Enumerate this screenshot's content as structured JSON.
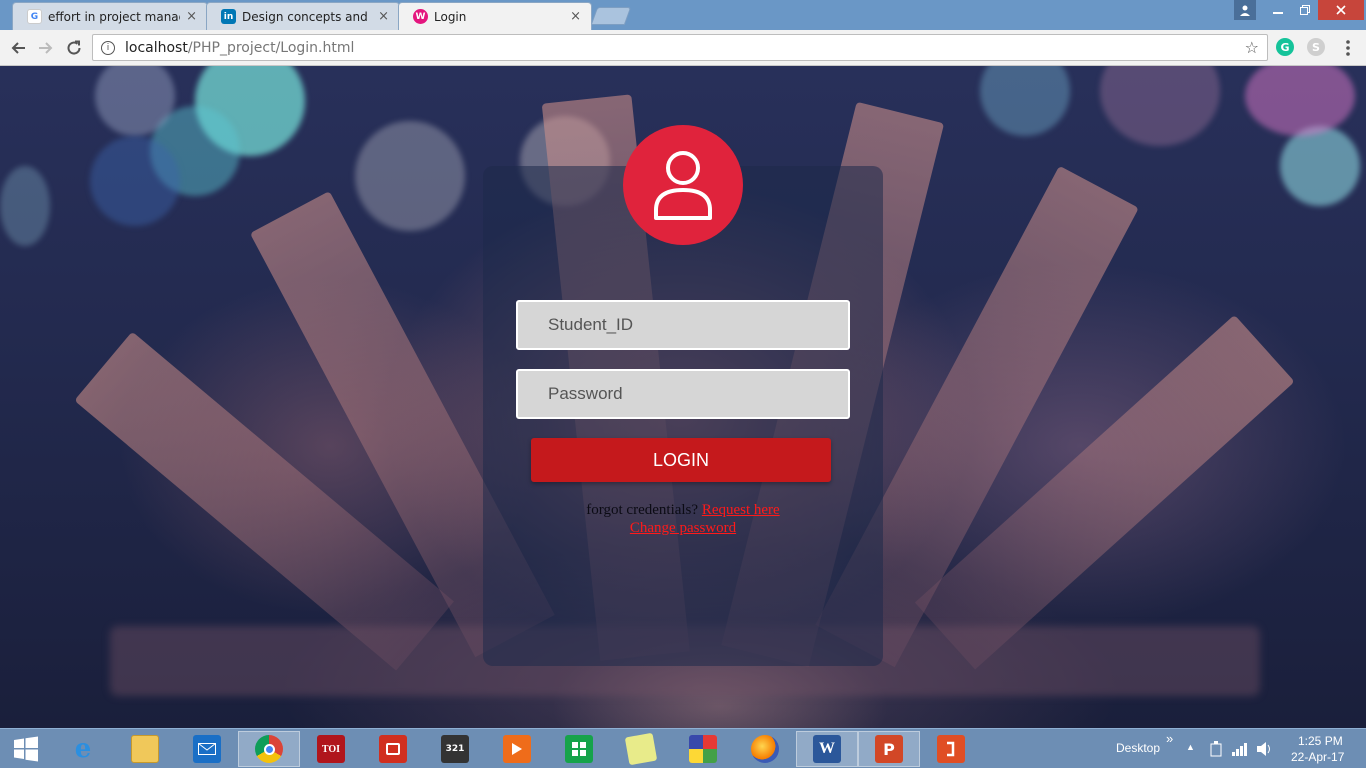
{
  "browser": {
    "tabs": [
      {
        "title": "effort in project managem",
        "favicon": "google-icon",
        "active": false
      },
      {
        "title": "Design concepts and prin",
        "favicon": "linkedin-icon",
        "active": false
      },
      {
        "title": "Login",
        "favicon": "site-icon",
        "active": true
      }
    ],
    "tab_close": "×",
    "url_host": "localhost",
    "url_path": "/PHP_project/Login.html",
    "colors": {
      "titlebar": "#6a97c6",
      "close_button": "#c7453b"
    }
  },
  "login": {
    "avatar_icon": "user-icon",
    "student_id_placeholder": "Student_ID",
    "password_placeholder": "Password",
    "login_label": "LOGIN",
    "forgot_text": "forgot credentials?",
    "request_link": "Request here",
    "change_password_link": "Change password",
    "colors": {
      "accent": "#e0233c",
      "button": "#c5191c",
      "link": "#ff1a1a"
    }
  },
  "taskbar": {
    "toi_label": "TOI",
    "desktop_label": "Desktop",
    "chevron": "»",
    "time": "1:25 PM",
    "date": "22-Apr-17",
    "pinned": [
      "start-icon",
      "ie-icon",
      "explorer-icon",
      "mail-icon",
      "chrome-icon",
      "toi-icon",
      "acrobat-icon",
      "media-player-classic-icon",
      "video-player-icon",
      "store-icon",
      "sticky-notes-icon",
      "paint-icon",
      "firefox-icon",
      "word-icon",
      "powerpoint-icon",
      "office-icon"
    ]
  }
}
